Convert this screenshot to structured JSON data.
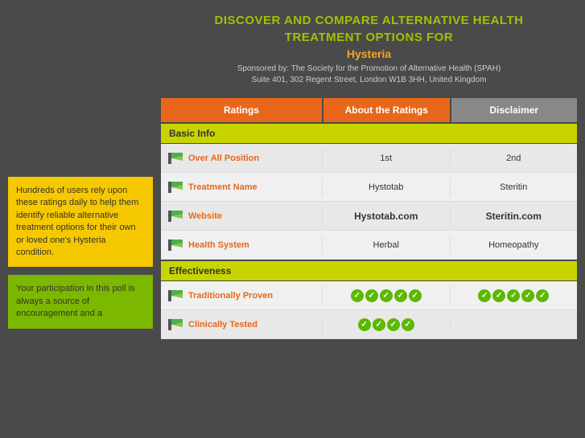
{
  "header": {
    "line1": "DISCOVER AND COMPARE  ALTERNATIVE HEALTH",
    "line2": "TREATMENT OPTIONS FOR",
    "condition": "Hysteria",
    "sponsor_line1": "Sponsored by: The Society for the Promotion of Alternative Health (SPAH)",
    "sponsor_line2": "Suite 401, 302 Regent Street, London W1B 3HH, United Kingdom"
  },
  "tabs": {
    "ratings": "Ratings",
    "about": "About the Ratings",
    "disclaimer": "Disclaimer"
  },
  "sections": [
    {
      "title": "Basic Info",
      "rows": [
        {
          "label": "Over All Position",
          "col1": "1st",
          "col2": "2nd",
          "col1_bold": false,
          "col2_bold": false,
          "col1_checks": 0,
          "col2_checks": 0
        },
        {
          "label": "Treatment Name",
          "col1": "Hystotab",
          "col2": "Steritin",
          "col1_bold": false,
          "col2_bold": false,
          "col1_checks": 0,
          "col2_checks": 0
        },
        {
          "label": "Website",
          "col1": "Hystotab.com",
          "col2": "Steritin.com",
          "col1_bold": true,
          "col2_bold": true,
          "col1_checks": 0,
          "col2_checks": 0
        },
        {
          "label": "Health System",
          "col1": "Herbal",
          "col2": "Homeopathy",
          "col1_bold": false,
          "col2_bold": false,
          "col1_checks": 0,
          "col2_checks": 0
        }
      ]
    },
    {
      "title": "Effectiveness",
      "rows": [
        {
          "label": "Traditionally Proven",
          "col1": "",
          "col2": "",
          "col1_checks": 5,
          "col2_checks": 5
        },
        {
          "label": "Clinically Tested",
          "col1": "",
          "col2": "",
          "col1_checks": 4,
          "col2_checks": 0
        }
      ]
    }
  ],
  "sidebar": {
    "yellow_box": "Hundreds of users rely upon these ratings daily to help them identify reliable alternative treatment options for their own or loved one's Hysteria condition.",
    "green_box": "Your participation in this poll is always a source of encouragement and a"
  }
}
